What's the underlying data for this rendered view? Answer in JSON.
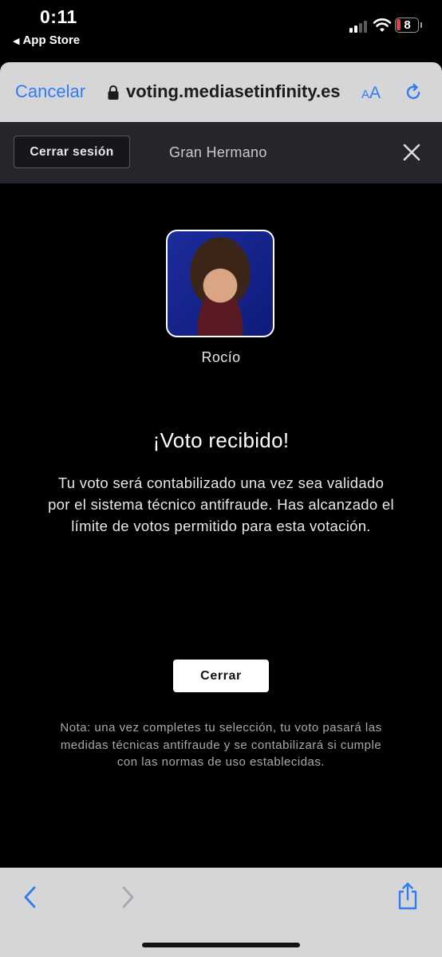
{
  "status_bar": {
    "time": "0:11",
    "back_app": "App Store",
    "battery_level": "8",
    "icons": [
      "cellular-signal-icon",
      "wifi-icon",
      "battery-icon"
    ]
  },
  "browser": {
    "cancel_label": "Cancelar",
    "url": "voting.mediasetinfinity.es",
    "text_size_label": "AA",
    "icons": [
      "lock-icon",
      "reload-icon"
    ]
  },
  "header": {
    "logout_label": "Cerrar sesión",
    "show_title": "Gran Hermano",
    "icons": [
      "close-icon"
    ]
  },
  "candidate": {
    "name": "Rocío"
  },
  "result": {
    "title": "¡Voto recibido!",
    "message": "Tu voto será contabilizado una vez sea validado por el sistema técnico antifraude. Has alcanzado el límite de votos permitido para esta votación.",
    "close_label": "Cerrar",
    "note": "Nota: una vez completes tu selección, tu voto pasará las medidas técnicas antifraude y se contabilizará si cumple con las normas de uso establecidas."
  },
  "bottom_toolbar": {
    "icons": [
      "chevron-left-icon",
      "chevron-right-icon",
      "share-icon"
    ]
  },
  "colors": {
    "accent": "#2e7cf6",
    "background": "#000000",
    "header_bg": "#24262b",
    "battery_low": "#e0443a"
  }
}
